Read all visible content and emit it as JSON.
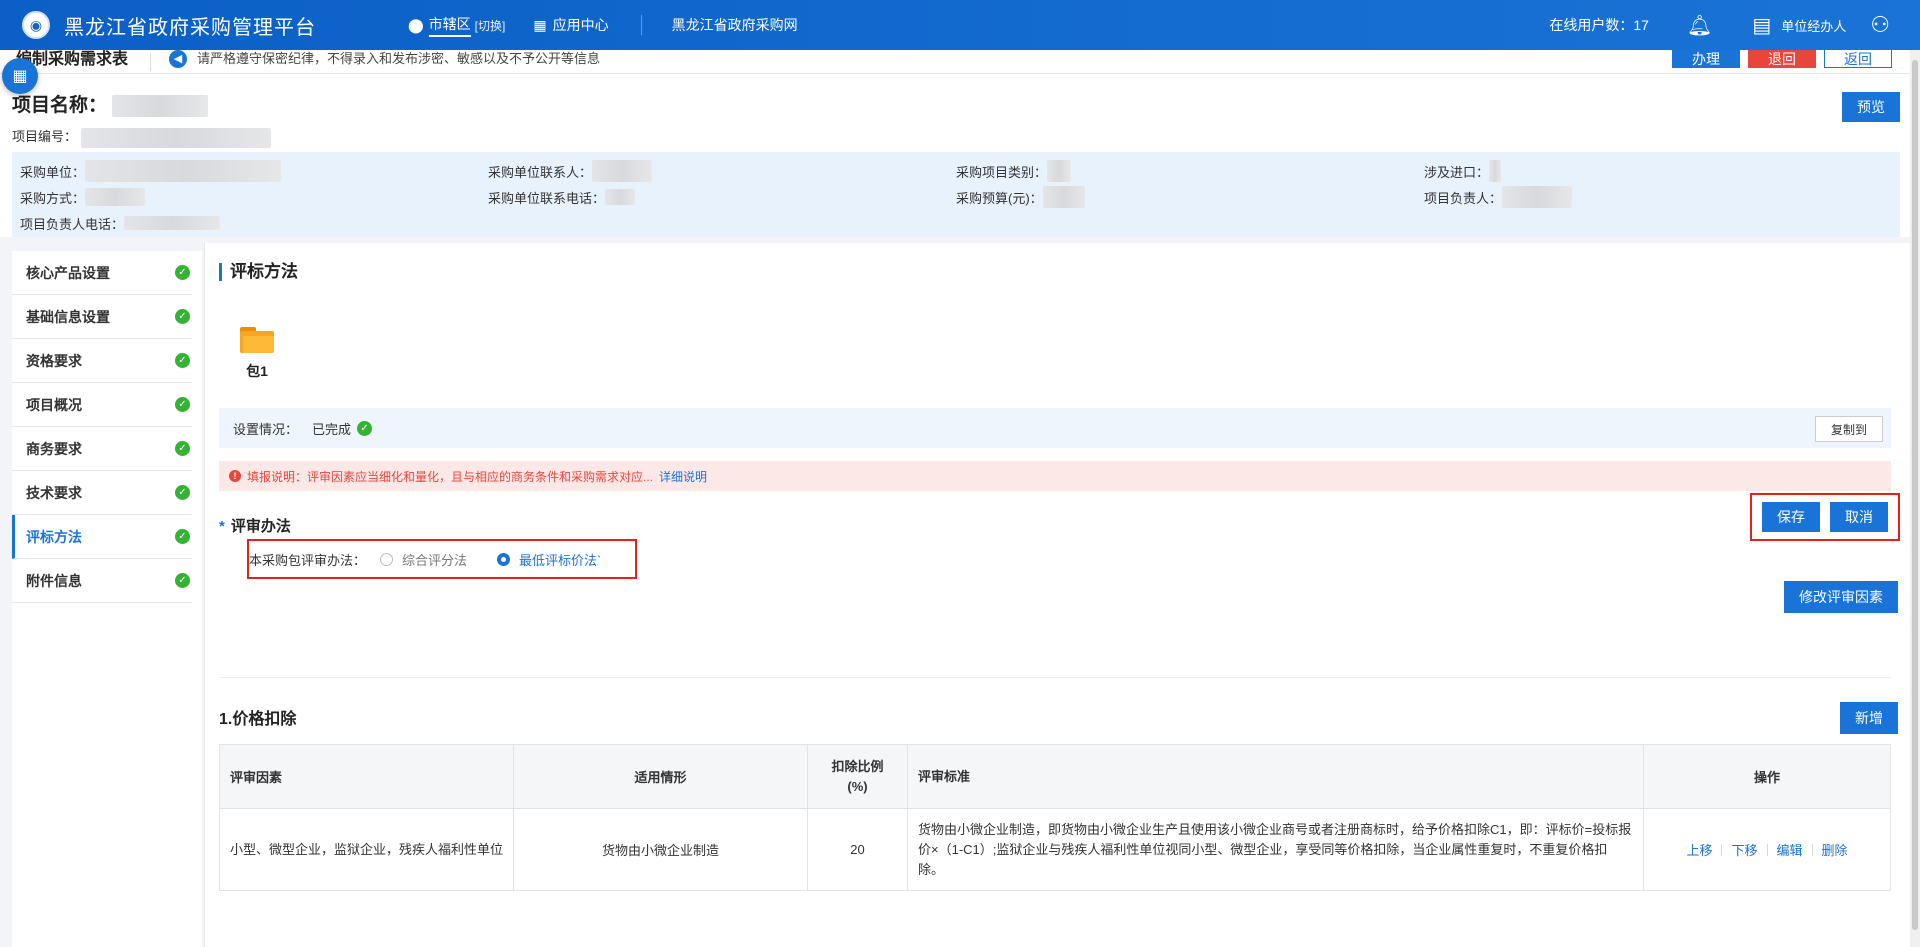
{
  "header": {
    "platform_title": "黑龙江省政府采购管理平台",
    "logo_icon": "emblem-icon",
    "region_label": "市辖区",
    "region_switch": "[切换]",
    "app_center": "应用中心",
    "site_link": "黑龙江省政府采购网",
    "online_users": "在线用户数：17",
    "agent_label": "单位经办人"
  },
  "subbar": {
    "page_title": "编制采购需求表",
    "notice": "请严格遵守保密纪律，不得录入和发布涉密、敏感以及不予公开等信息",
    "btn_handle": "办理",
    "btn_reject": "退回",
    "btn_back": "返回"
  },
  "project": {
    "name_label": "项目名称：",
    "no_label": "项目编号：",
    "preview_btn": "预览",
    "info": [
      [
        "采购单位：",
        "采购单位联系人：",
        "采购项目类别：",
        "涉及进口："
      ],
      [
        "采购方式：",
        "采购单位联系电话：",
        "采购预算(元)：",
        "项目负责人："
      ],
      [
        "项目负责人电话：",
        "",
        "",
        ""
      ]
    ]
  },
  "leftnav": {
    "items": [
      {
        "label": "核心产品设置",
        "active": false
      },
      {
        "label": "基础信息设置",
        "active": false
      },
      {
        "label": "资格要求",
        "active": false
      },
      {
        "label": "项目概况",
        "active": false
      },
      {
        "label": "商务要求",
        "active": false
      },
      {
        "label": "技术要求",
        "active": false
      },
      {
        "label": "评标方法",
        "active": true
      },
      {
        "label": "附件信息",
        "active": false
      }
    ]
  },
  "main": {
    "section_title": "评标方法",
    "package_label": "包1",
    "status_label": "设置情况：",
    "status_value": "已完成",
    "copy_btn": "复制到",
    "warn_text": "填报说明：评审因素应当细化和量化，且与相应的商务条件和采购需求对应...",
    "warn_link": "详细说明",
    "method_title": "评审办法",
    "method_required": "*",
    "method_prompt": "本采购包评审办法：",
    "option_1": "综合评分法",
    "option_2": "最低评标价法`",
    "selected_option": "最低评标价法",
    "save_btn": "保存",
    "cancel_btn": "取消",
    "modify_btn": "修改评审因素",
    "price_title": "1.价格扣除",
    "add_btn": "新增",
    "table": {
      "headers": [
        "评审因素",
        "适用情形",
        "扣除比例(%)",
        "评审标准",
        "操作"
      ],
      "rows": [
        {
          "factor": "小型、微型企业，监狱企业，残疾人福利性单位",
          "case": "货物由小微企业制造",
          "ratio": "20",
          "standard": "货物由小微企业制造，即货物由小微企业生产且使用该小微企业商号或者注册商标时，给予价格扣除C1，即：评标价=投标报价×（1-C1）;监狱企业与残疾人福利性单位视同小型、微型企业，享受同等价格扣除，当企业属性重复时，不重复价格扣除。",
          "ops": [
            "上移",
            "下移",
            "编辑",
            "删除"
          ]
        }
      ]
    }
  },
  "colors": {
    "primary": "#1a73d6",
    "danger": "#e8453c",
    "success": "#34b233",
    "highlight_border": "#e8201c"
  }
}
